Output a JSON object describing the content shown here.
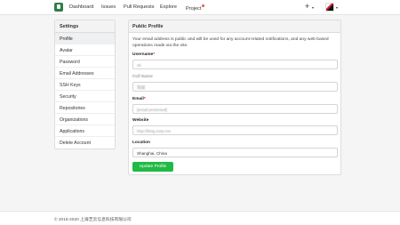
{
  "topbar": {
    "nav": [
      "Dashboard",
      "Issues",
      "Pull Requests",
      "Explore",
      "Project"
    ],
    "plus_icon": "+",
    "caret_icon": "▾"
  },
  "sidebar": {
    "heading": "Settings",
    "items": [
      "Profile",
      "Avatar",
      "Password",
      "Email Addresses",
      "SSH Keys",
      "Security",
      "Repositories",
      "Organizations",
      "Applications",
      "Delete Account"
    ]
  },
  "profile": {
    "heading": "Public Profile",
    "description": "Your email address is public and will be used for any account related notifications, and any web based operations made via the site.",
    "username_label": "Username",
    "username_value": "zb",
    "fullname_label": "Full Name",
    "fullname_value": "周斌",
    "email_label": "Email",
    "email_value": "[email protected]",
    "website_label": "Website",
    "website_value": "http://blog.zorp.me",
    "location_label": "Location",
    "location_value": "Shanghai, China",
    "required_mark": "*",
    "submit_label": "Update Profile"
  },
  "footer": {
    "copyright": "© 2016-2020 上海芝云信息科技有限公司"
  },
  "colors": {
    "brand": "#2d7d46",
    "primary_button": "#21ba45",
    "required": "#db2828",
    "notification_dot": "#e05d44"
  }
}
